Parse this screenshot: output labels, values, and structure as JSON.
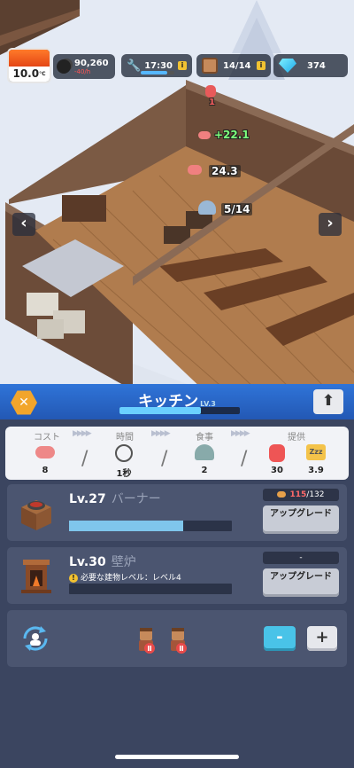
{
  "hud": {
    "temperature": "10.0",
    "temperature_unit": "°C",
    "coal": "90,260",
    "coal_rate": "-40/h",
    "work_time": "17:30",
    "population": "14/14",
    "gems": "374"
  },
  "scene": {
    "food_rate": "+22.1",
    "meat_count": "24.3",
    "dining_count": "5/14",
    "alert_count": "1"
  },
  "building": {
    "name": "キッチン",
    "level": "LV.3",
    "progress": 0.68
  },
  "stats": {
    "headers": [
      "コスト",
      "時間",
      "食事",
      "提供"
    ],
    "values": [
      "8",
      "1秒",
      "2",
      "30",
      "3.9"
    ]
  },
  "upgrades": [
    {
      "level": "Lv.27",
      "name": "バーナー",
      "cost_have": "115",
      "cost_total": "/132",
      "progress": 0.7,
      "button": "アップグレード",
      "icon": "burner-icon"
    },
    {
      "level": "Lv.30",
      "name": "壁炉",
      "cost": "-",
      "requirement": "必要な建物レベル：レベル4",
      "progress": 0,
      "button": "アップグレード",
      "icon": "fireplace-icon"
    }
  ],
  "workers": {
    "minus": "-",
    "plus": "+"
  },
  "nav": {
    "left": "‹",
    "right": "›",
    "up": "⬆"
  }
}
